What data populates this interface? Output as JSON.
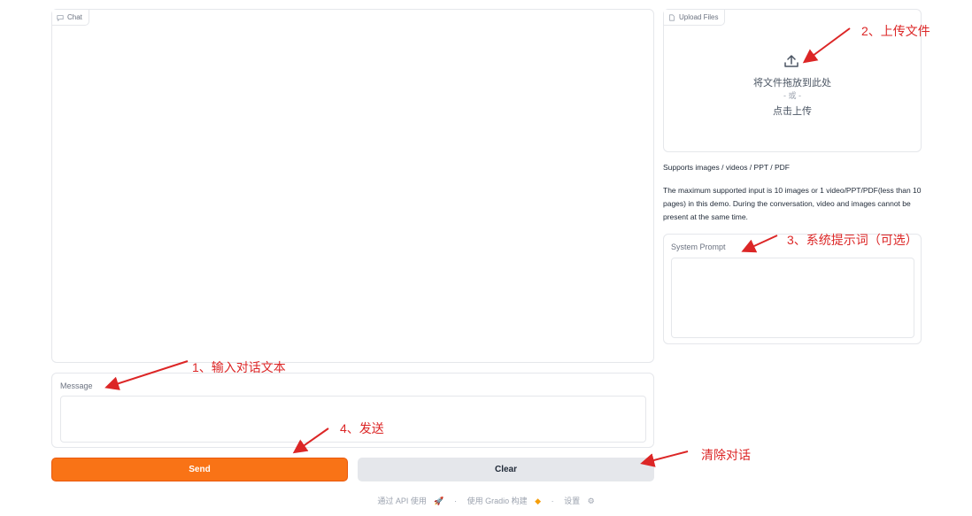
{
  "chat": {
    "label": "Chat"
  },
  "message": {
    "label": "Message",
    "placeholder": ""
  },
  "buttons": {
    "send": "Send",
    "clear": "Clear"
  },
  "upload": {
    "label": "Upload Files",
    "drop_text": "将文件拖放到此处",
    "or_text": "- 或 -",
    "click_text": "点击上传"
  },
  "info": {
    "supports": "Supports images / videos / PPT / PDF",
    "limit": "The maximum supported input is 10 images or 1 video/PPT/PDF(less than 10 pages) in this demo. During the conversation, video and images cannot be present at the same time."
  },
  "system_prompt": {
    "label": "System Prompt",
    "placeholder": ""
  },
  "annotations": {
    "a1": "1、输入对话文本",
    "a2": "2、上传文件",
    "a3": "3、系统提示词（可选）",
    "a4": "4、发送",
    "a5": "清除对话"
  },
  "footer": {
    "api": "通过 API 使用",
    "sep1": "·",
    "gradio": "使用 Gradio 构建",
    "sep2": "·",
    "settings": "设置"
  },
  "colors": {
    "accent": "#f97316",
    "annotation": "#dc2626"
  }
}
